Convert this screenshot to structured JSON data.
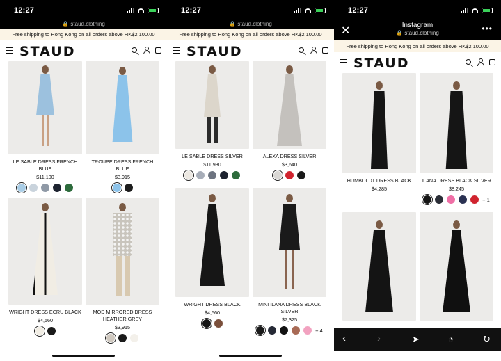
{
  "status": {
    "time": "12:27"
  },
  "browser": {
    "url": "staud.clothing"
  },
  "instagram": {
    "title": "Instagram",
    "url": "staud.clothing"
  },
  "banner": "Free shipping to Hong Kong on all orders above HK$2,100.00",
  "logo": "STAUD",
  "panels": [
    {
      "products": [
        {
          "name": "LE SABLE DRESS FRENCH BLUE",
          "price": "$11,100",
          "dress": "#9cc1de",
          "swatches": [
            "#a9cde6",
            "#c9d3dc",
            "#8f99a6",
            "#1d2330",
            "#2d6b3c"
          ]
        },
        {
          "name": "TROUPE DRESS FRENCH BLUE",
          "price": "$3,915",
          "dress": "#8cc3ea",
          "swatches": [
            "#8cc3ea",
            "#1c1c1c"
          ]
        },
        {
          "name": "WRIGHT DRESS ECRU BLACK",
          "price": "$4,560",
          "dress": "#f1ede4",
          "swatches": [
            "#f1ede4",
            "#1a1a1a"
          ]
        },
        {
          "name": "MOD MIRRORED DRESS HEATHER GREY",
          "price": "$3,915",
          "dress": "#c9c5bd",
          "swatches": [
            "#cfc8bf",
            "#1a1a1a",
            "#f3f0ea"
          ]
        }
      ]
    },
    {
      "products": [
        {
          "name": "LE SABLE DRESS SILVER",
          "price": "$11,930",
          "dress": "#dcd6cb",
          "swatches": [
            "#ece8e2",
            "#a7adb8",
            "#6d7480",
            "#1d2330",
            "#2d6b3c"
          ]
        },
        {
          "name": "ALEXA DRESS SILVER",
          "price": "$3,640",
          "dress": "#c4c1bd",
          "swatches": [
            "#d9d7d4",
            "#d0232e",
            "#1a1a1a"
          ]
        },
        {
          "name": "WRIGHT DRESS BLACK",
          "price": "$4,560",
          "dress": "#161616",
          "swatches": [
            "#161616",
            "#7a4f3b"
          ]
        },
        {
          "name": "MINI ILANA DRESS BLACK SILVER",
          "price": "$7,325",
          "dress": "#1a1a1a",
          "swatches": [
            "#1a1a1a",
            "#262a36",
            "#111111",
            "#a86a55",
            "#f2a2c0"
          ],
          "more": "+ 4"
        }
      ]
    },
    {
      "products": [
        {
          "name": "HUMBOLDT DRESS BLACK",
          "price": "$4,285",
          "dress": "#151515",
          "swatches": []
        },
        {
          "name": "ILANA DRESS BLACK SILVER",
          "price": "$8,245",
          "dress": "#151515",
          "swatches": [
            "#151515",
            "#2a2d36",
            "#ef6fa6",
            "#2a3152",
            "#d0232e"
          ],
          "more": "+ 1"
        },
        {
          "name": "",
          "price": "",
          "dress": "#141414",
          "swatches": []
        },
        {
          "name": "",
          "price": "",
          "dress": "#101010",
          "swatches": []
        }
      ]
    }
  ]
}
